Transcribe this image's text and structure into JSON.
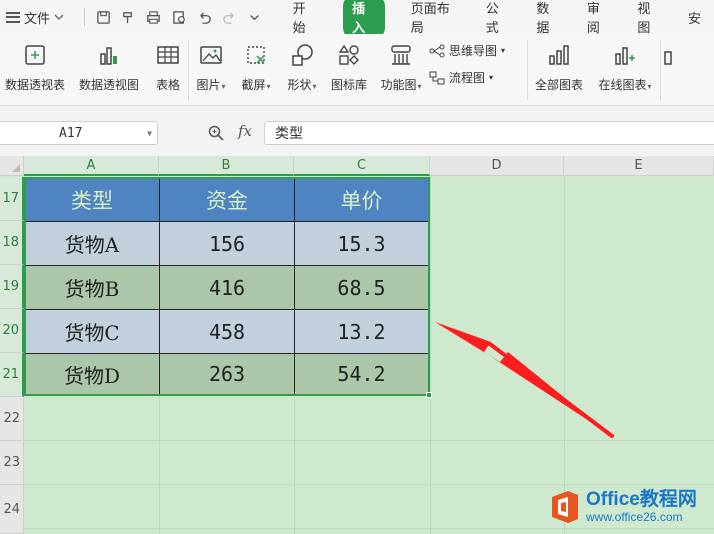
{
  "menubar": {
    "file_label": "文件",
    "tabs": [
      {
        "label": "开始",
        "active": false
      },
      {
        "label": "插入",
        "active": true
      },
      {
        "label": "页面布局",
        "active": false
      },
      {
        "label": "公式",
        "active": false
      },
      {
        "label": "数据",
        "active": false
      },
      {
        "label": "审阅",
        "active": false
      },
      {
        "label": "视图",
        "active": false
      },
      {
        "label": "安",
        "active": false
      }
    ]
  },
  "ribbon": {
    "pivot_table": "数据透视表",
    "pivot_chart": "数据透视图",
    "table": "表格",
    "picture": "图片",
    "screenshot": "截屏",
    "shape": "形状",
    "icon_lib": "图标库",
    "func_chart": "功能图",
    "mind_map": "思维导图",
    "flow_chart": "流程图",
    "all_charts": "全部图表",
    "online_charts": "在线图表"
  },
  "formula_bar": {
    "name_box": "A17",
    "fx": "fx",
    "value": "类型"
  },
  "grid": {
    "columns": [
      "A",
      "B",
      "C",
      "D",
      "E"
    ],
    "rows": [
      "17",
      "18",
      "19",
      "20",
      "21",
      "22",
      "23",
      "24"
    ],
    "table": {
      "headers": [
        "类型",
        "资金",
        "单价"
      ],
      "rows": [
        [
          "货物A",
          "156",
          "15.3"
        ],
        [
          "货物B",
          "416",
          "68.5"
        ],
        [
          "货物C",
          "458",
          "13.2"
        ],
        [
          "货物D",
          "263",
          "54.2"
        ]
      ]
    }
  },
  "watermark": {
    "title": "Office教程网",
    "url": "www.office26.com"
  },
  "colors": {
    "accent": "#2e9c4f",
    "header_fill": "#4f84c3",
    "band_odd": "#c2cfdc",
    "band_even": "#abc6a8",
    "annotation_arrow": "#ff1e1e"
  }
}
